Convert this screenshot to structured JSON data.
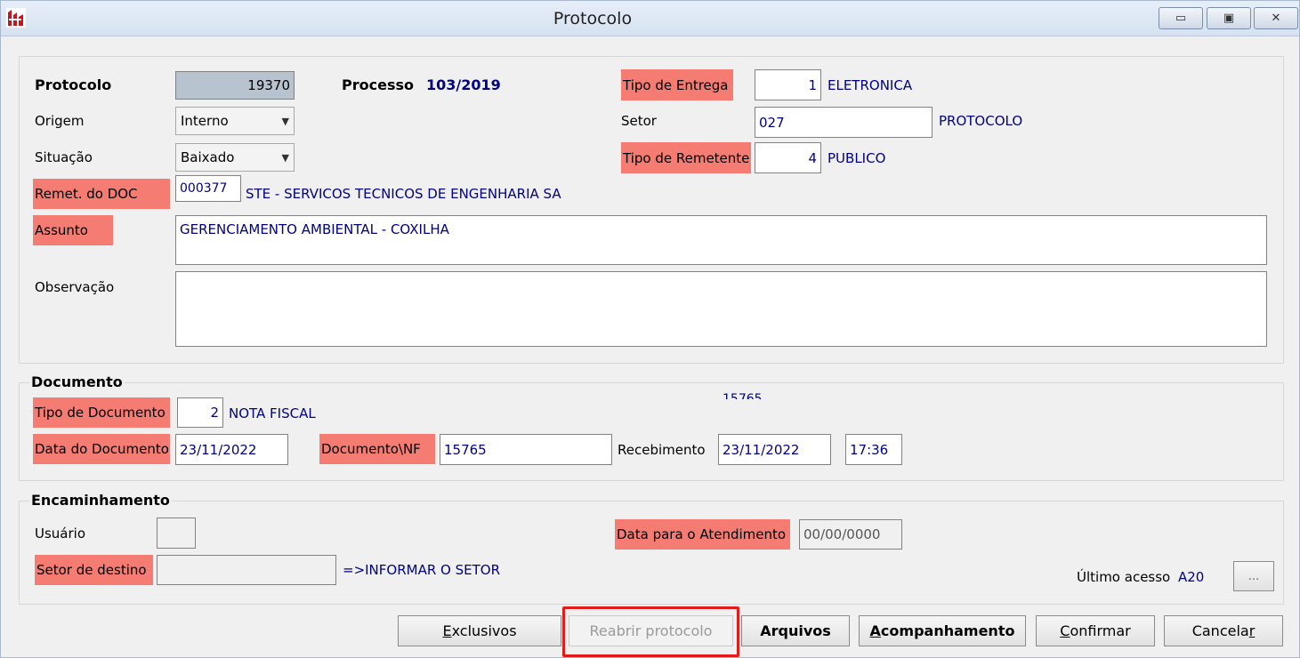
{
  "window": {
    "title": "Protocolo",
    "controls": {
      "minimize": "▭",
      "restore": "▣",
      "close": "✕"
    }
  },
  "main": {
    "protocolo_label": "Protocolo",
    "protocolo_value": "19370",
    "processo_label": "Processo",
    "processo_value": "103/2019",
    "tipo_entrega_label": "Tipo de Entrega",
    "tipo_entrega_code": "1",
    "tipo_entrega_desc": "ELETRONICA",
    "origem_label": "Origem",
    "origem_value": "Interno",
    "setor_label": "Setor",
    "setor_code": "027",
    "setor_desc": "PROTOCOLO",
    "situacao_label": "Situação",
    "situacao_value": "Baixado",
    "tipo_remetente_label": "Tipo de Remetente",
    "tipo_remetente_code": "4",
    "tipo_remetente_desc": "PUBLICO",
    "remet_label": "Remet. do DOC",
    "remet_code": "000377",
    "remet_desc": "STE - SERVICOS TECNICOS DE ENGENHARIA SA",
    "assunto_label": "Assunto",
    "assunto_value": "GERENCIAMENTO AMBIENTAL - COXILHA",
    "observacao_label": "Observação",
    "observacao_value": ""
  },
  "documento": {
    "group_title": "Documento",
    "partial_text": "15765",
    "tipo_doc_label": "Tipo de Documento",
    "tipo_doc_code": "2",
    "tipo_doc_desc": "NOTA FISCAL",
    "data_doc_label": "Data do Documento",
    "data_doc_value": "23/11/2022",
    "documento_nf_label": "Documento\\NF",
    "documento_nf_value": "15765",
    "recebimento_label": "Recebimento",
    "recebimento_date": "23/11/2022",
    "recebimento_time": "17:36"
  },
  "encaminhamento": {
    "group_title": "Encaminhamento",
    "usuario_label": "Usuário",
    "usuario_value": "",
    "data_atendimento_label": "Data para o Atendimento",
    "data_atendimento_value": "00/00/0000",
    "setor_destino_label": "Setor de destino",
    "setor_destino_value": "",
    "setor_hint": "=>INFORMAR O SETOR",
    "ultimo_acesso_label": "Último acesso",
    "ultimo_acesso_value": "A20",
    "ellipsis": "..."
  },
  "buttons": {
    "exclusivos_mn": "E",
    "exclusivos_rest": "xclusivos",
    "reabrir": "Reabrir protocolo",
    "arquivos": "Arquivos",
    "acompanhamento_mn": "A",
    "acompanhamento_rest": "companhamento",
    "confirmar_mn": "C",
    "confirmar_rest": "onfirmar",
    "cancelar_pre": "Cancela",
    "cancelar_mn": "r"
  },
  "colors": {
    "required": "#f47c72",
    "value_text": "#000080",
    "highlight": "#e51b1b"
  }
}
